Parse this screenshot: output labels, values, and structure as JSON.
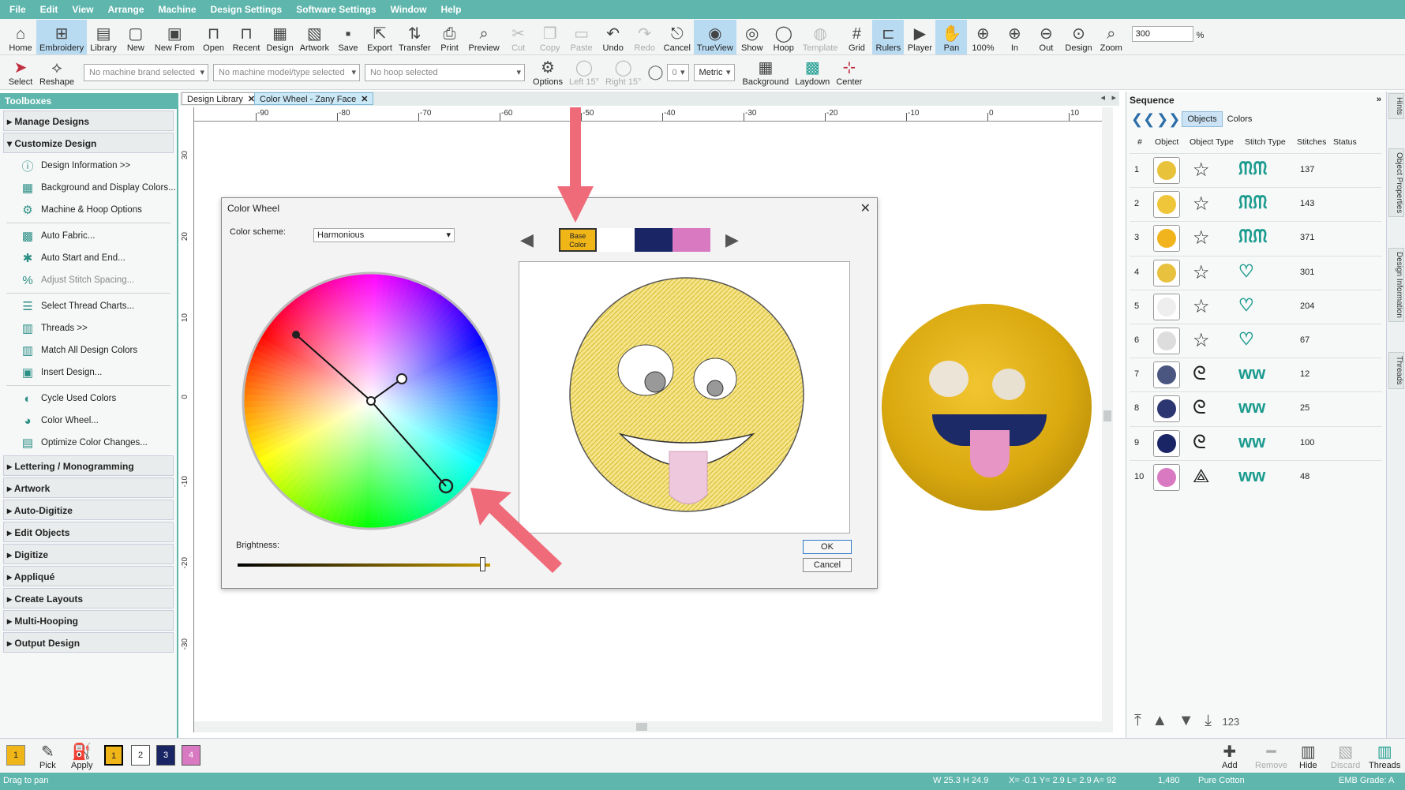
{
  "menu": [
    "File",
    "Edit",
    "View",
    "Arrange",
    "Machine",
    "Design Settings",
    "Software Settings",
    "Window",
    "Help"
  ],
  "toolbar1": [
    {
      "label": "Home",
      "icon": "home-icon",
      "glyph": "⌂",
      "active": false,
      "disabled": false
    },
    {
      "label": "Embroidery",
      "icon": "embroidery-icon",
      "glyph": "⊞",
      "active": true,
      "disabled": false
    },
    {
      "label": "Library",
      "icon": "library-icon",
      "glyph": "▤",
      "active": false,
      "disabled": false
    },
    {
      "label": "New",
      "icon": "new-icon",
      "glyph": "▢",
      "active": false,
      "disabled": false
    },
    {
      "label": "New From",
      "icon": "new-from-icon",
      "glyph": "▣",
      "active": false,
      "disabled": false
    },
    {
      "label": "Open",
      "icon": "open-icon",
      "glyph": "⊓",
      "active": false,
      "disabled": false
    },
    {
      "label": "Recent",
      "icon": "recent-icon",
      "glyph": "⊓",
      "active": false,
      "disabled": false
    },
    {
      "label": "Design",
      "icon": "design-icon",
      "glyph": "▦",
      "active": false,
      "disabled": false
    },
    {
      "label": "Artwork",
      "icon": "artwork-icon",
      "glyph": "▧",
      "active": false,
      "disabled": false
    },
    {
      "label": "Save",
      "icon": "save-icon",
      "glyph": "▪",
      "active": false,
      "disabled": false
    },
    {
      "label": "Export",
      "icon": "export-icon",
      "glyph": "⇱",
      "active": false,
      "disabled": false
    },
    {
      "label": "Transfer",
      "icon": "transfer-icon",
      "glyph": "⇅",
      "active": false,
      "disabled": false
    },
    {
      "label": "Print",
      "icon": "print-icon",
      "glyph": "⎙",
      "active": false,
      "disabled": false
    },
    {
      "label": "Preview",
      "icon": "preview-icon",
      "glyph": "⌕",
      "active": false,
      "disabled": false
    },
    {
      "label": "Cut",
      "icon": "cut-icon",
      "glyph": "✂",
      "active": false,
      "disabled": true
    },
    {
      "label": "Copy",
      "icon": "copy-icon",
      "glyph": "❐",
      "active": false,
      "disabled": true
    },
    {
      "label": "Paste",
      "icon": "paste-icon",
      "glyph": "▭",
      "active": false,
      "disabled": true
    },
    {
      "label": "Undo",
      "icon": "undo-icon",
      "glyph": "↶",
      "active": false,
      "disabled": false
    },
    {
      "label": "Redo",
      "icon": "redo-icon",
      "glyph": "↷",
      "active": false,
      "disabled": true
    },
    {
      "label": "Cancel",
      "icon": "cancel-icon",
      "glyph": "⎋",
      "active": false,
      "disabled": false
    },
    {
      "label": "TrueView",
      "icon": "trueview-icon",
      "glyph": "◉",
      "active": true,
      "disabled": false
    },
    {
      "label": "Show",
      "icon": "show-icon",
      "glyph": "◎",
      "active": false,
      "disabled": false
    },
    {
      "label": "Hoop",
      "icon": "hoop-icon",
      "glyph": "◯",
      "active": false,
      "disabled": false
    },
    {
      "label": "Template",
      "icon": "template-icon",
      "glyph": "◍",
      "active": false,
      "disabled": true
    },
    {
      "label": "Grid",
      "icon": "grid-icon",
      "glyph": "#",
      "active": false,
      "disabled": false
    },
    {
      "label": "Rulers",
      "icon": "rulers-icon",
      "glyph": "⊏",
      "active": true,
      "disabled": false
    },
    {
      "label": "Player",
      "icon": "player-icon",
      "glyph": "▶",
      "active": false,
      "disabled": false
    },
    {
      "label": "Pan",
      "icon": "pan-icon",
      "glyph": "✋",
      "active": true,
      "disabled": false
    },
    {
      "label": "100%",
      "icon": "zoom-100-icon",
      "glyph": "⊕",
      "active": false,
      "disabled": false
    },
    {
      "label": "In",
      "icon": "zoom-in-icon",
      "glyph": "⊕",
      "active": false,
      "disabled": false
    },
    {
      "label": "Out",
      "icon": "zoom-out-icon",
      "glyph": "⊖",
      "active": false,
      "disabled": false
    },
    {
      "label": "Design",
      "icon": "zoom-design-icon",
      "glyph": "⊙",
      "active": false,
      "disabled": false
    },
    {
      "label": "Zoom",
      "icon": "zoom-icon",
      "glyph": "⌕",
      "active": false,
      "disabled": false
    }
  ],
  "zoom": {
    "value": "300",
    "unit": "%"
  },
  "toolbar2": {
    "select": "Select",
    "reshape": "Reshape",
    "machine_brand": "No machine brand selected",
    "machine_model": "No machine model/type selected",
    "hoop": "No hoop selected",
    "options": "Options",
    "left15": "Left 15°",
    "right15": "Right 15°",
    "angle": "0",
    "units": "Metric",
    "background": "Background",
    "laydown": "Laydown",
    "center": "Center"
  },
  "toolbox": {
    "title": "Toolboxes",
    "manage": "Manage Designs",
    "customize": "Customize Design",
    "items": [
      {
        "label": "Design Information >>",
        "icon": "info-icon",
        "glyph": "ⓘ",
        "disabled": false
      },
      {
        "label": "Background and Display Colors...",
        "icon": "background-colors-icon",
        "glyph": "▦",
        "disabled": false
      },
      {
        "label": "Machine & Hoop Options",
        "icon": "machine-hoop-icon",
        "glyph": "⚙",
        "disabled": false
      },
      {
        "label": "Auto Fabric...",
        "icon": "auto-fabric-icon",
        "glyph": "▩",
        "disabled": false
      },
      {
        "label": "Auto Start and End...",
        "icon": "auto-start-end-icon",
        "glyph": "✱",
        "disabled": false
      },
      {
        "label": "Adjust Stitch Spacing...",
        "icon": "stitch-spacing-icon",
        "glyph": "%",
        "disabled": true
      },
      {
        "label": "Select Thread Charts...",
        "icon": "thread-charts-icon",
        "glyph": "☰",
        "disabled": false
      },
      {
        "label": "Threads >>",
        "icon": "threads-icon",
        "glyph": "▥",
        "disabled": false
      },
      {
        "label": "Match All Design Colors",
        "icon": "match-colors-icon",
        "glyph": "▥",
        "disabled": false
      },
      {
        "label": "Insert Design...",
        "icon": "insert-design-icon",
        "glyph": "▣",
        "disabled": false
      },
      {
        "label": "Cycle Used Colors",
        "icon": "cycle-colors-icon",
        "glyph": "◐",
        "disabled": false
      },
      {
        "label": "Color Wheel...",
        "icon": "color-wheel-icon",
        "glyph": "◕",
        "disabled": false
      },
      {
        "label": "Optimize Color Changes...",
        "icon": "optimize-colors-icon",
        "glyph": "▤",
        "disabled": false
      }
    ],
    "sections": [
      "Lettering / Monogramming",
      "Artwork",
      "Auto-Digitize",
      "Edit Objects",
      "Digitize",
      "Appliqué",
      "Create Layouts",
      "Multi-Hooping",
      "Output Design"
    ]
  },
  "tabs": [
    {
      "label": "Design Library",
      "active": false
    },
    {
      "label": "Color Wheel - Zany Face",
      "active": true
    }
  ],
  "ruler": {
    "h": [
      "-90",
      "-80",
      "-70",
      "-60",
      "-50",
      "-40",
      "-30",
      "-20",
      "-10",
      "0",
      "10"
    ],
    "v": [
      "30",
      "20",
      "10",
      "0",
      "-10",
      "-20",
      "-30"
    ]
  },
  "dialog": {
    "title": "Color Wheel",
    "scheme_label": "Color scheme:",
    "scheme_value": "Harmonious",
    "base_label": "Base Color",
    "swatches": [
      "#f0b618",
      "#ffffff",
      "#1a2566",
      "#d879c2"
    ],
    "brightness_label": "Brightness:",
    "brightness_value": 0.97,
    "ok": "OK",
    "cancel": "Cancel"
  },
  "sequence": {
    "title": "Sequence",
    "tab_objects": "Objects",
    "tab_colors": "Colors",
    "columns": [
      "#",
      "Object",
      "Object Type",
      "Stitch Type",
      "Stitches",
      "Status"
    ],
    "rows": [
      {
        "n": "1",
        "color": "#e7c23a",
        "type": "star-icon",
        "stitch": "satin-icon",
        "count": "137"
      },
      {
        "n": "2",
        "color": "#efc63a",
        "type": "star-icon",
        "stitch": "satin-icon",
        "count": "143"
      },
      {
        "n": "3",
        "color": "#f1b41c",
        "type": "star-icon",
        "stitch": "satin-icon",
        "count": "371"
      },
      {
        "n": "4",
        "color": "#e8c13e",
        "type": "star-icon",
        "stitch": "fill-icon",
        "count": "301"
      },
      {
        "n": "5",
        "color": "#eeeeee",
        "type": "star-icon",
        "stitch": "fill-icon",
        "count": "204"
      },
      {
        "n": "6",
        "color": "#dddddd",
        "type": "star-icon",
        "stitch": "fill-icon",
        "count": "67"
      },
      {
        "n": "7",
        "color": "#4a5580",
        "type": "freehand-icon",
        "stitch": "zigzag-icon",
        "count": "12"
      },
      {
        "n": "8",
        "color": "#2c3670",
        "type": "freehand-icon",
        "stitch": "zigzag-icon",
        "count": "25"
      },
      {
        "n": "9",
        "color": "#1a2566",
        "type": "freehand-icon",
        "stitch": "zigzag-icon",
        "count": "100"
      },
      {
        "n": "10",
        "color": "#d879c2",
        "type": "polygon-icon",
        "stitch": "zigzag-icon",
        "count": "48"
      }
    ]
  },
  "right_tabs": [
    "Hints",
    "Object Properties",
    "Design Information",
    "Threads"
  ],
  "bottom": {
    "color1": "1",
    "color2": "2",
    "color3": "3",
    "color4": "4",
    "pick": "Pick",
    "apply": "Apply",
    "add": "Add",
    "remove": "Remove",
    "hide": "Hide",
    "discard": "Discard",
    "threads": "Threads"
  },
  "status": {
    "hint": "Drag to pan",
    "size": "W 25.3 H 24.9",
    "coords": "X= -0.1 Y= 2.9 L= 2.9 A= 92",
    "stitches": "1,480",
    "thread": "Pure Cotton",
    "grade": "EMB Grade: A"
  }
}
